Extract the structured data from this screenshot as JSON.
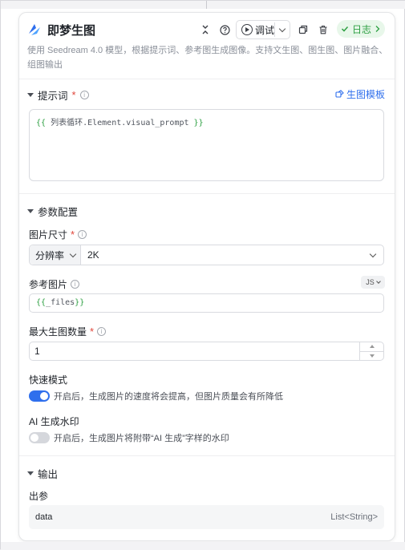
{
  "node": {
    "title": "即梦生图",
    "description": "使用 Seedream 4.0 模型，根据提示词、参考图生成图像。支持文生图、图生图、图片融合、组图输出"
  },
  "header": {
    "debug_label": "调试",
    "log_label": "日志",
    "colors": {
      "accent": "#2f6fed",
      "success": "#2ea043",
      "required": "#e0453a"
    }
  },
  "prompt_section": {
    "title": "提示词",
    "template_link": "生图模板",
    "value_open": "{{",
    "value_var": " 列表循环.Element.visual_prompt ",
    "value_close": "}}"
  },
  "params_section": {
    "title": "参数配置",
    "image_size": {
      "label": "图片尺寸",
      "mode": "分辨率",
      "value": "2K"
    },
    "reference_image": {
      "label": "参考图片",
      "badge": "JS",
      "value_open": "{{",
      "value_var": "_files",
      "value_close": "}}"
    },
    "max_count": {
      "label": "最大生图数量",
      "value": "1"
    },
    "fast_mode": {
      "label": "快速模式",
      "enabled": true,
      "hint": "开启后，生成图片的速度将会提高，但图片质量会有所降低"
    },
    "watermark": {
      "label": "AI 生成水印",
      "enabled": false,
      "hint": "开启后，生成图片将附带“AI 生成”字样的水印"
    }
  },
  "output_section": {
    "title": "输出",
    "params_label": "出参",
    "rows": [
      {
        "name": "data",
        "type": "List<String>"
      }
    ]
  }
}
